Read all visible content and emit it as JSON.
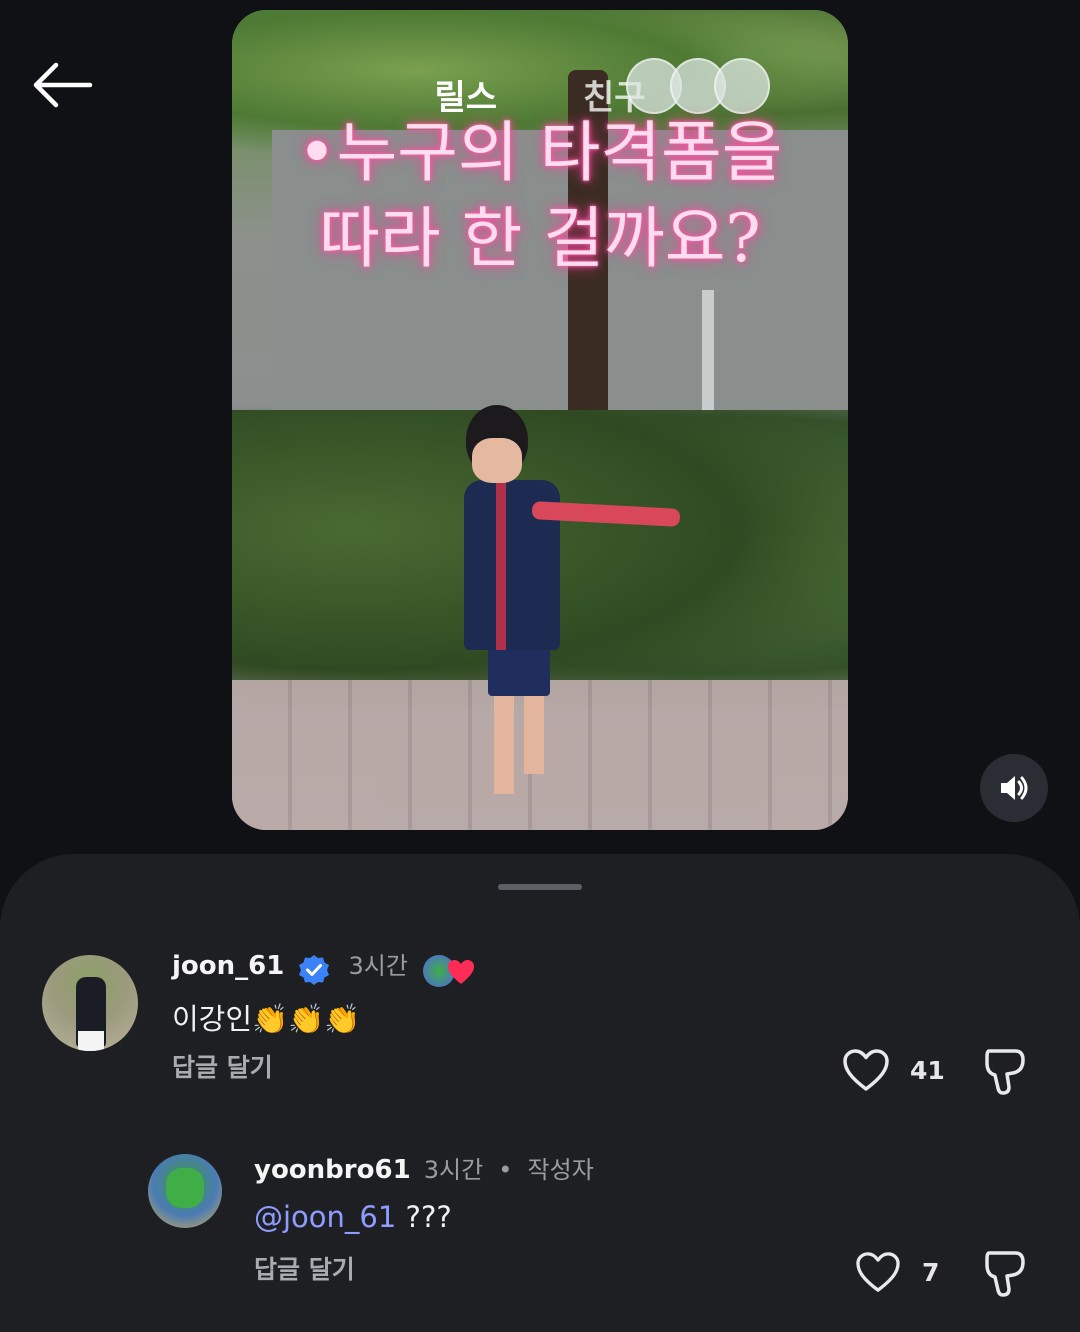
{
  "header": {
    "back_icon": "arrow-left-icon"
  },
  "video": {
    "tabs": [
      "릴스",
      "친구"
    ],
    "caption_line1": "•누구의 타격폼을",
    "caption_line2": "따라 한 걸까요?",
    "sound_icon": "speaker-icon"
  },
  "comments": [
    {
      "username": "joon_61",
      "verified": true,
      "time": "3시간",
      "text": "이강인👏👏👏",
      "reply_label": "답글 달기",
      "likes": "41",
      "liked_by_author": true
    },
    {
      "username": "yoonbro61",
      "time": "3시간",
      "separator": "•",
      "author_badge": "작성자",
      "mention": "@joon_61",
      "text": "???",
      "reply_label": "답글 달기",
      "likes": "7"
    }
  ],
  "colors": {
    "background": "#0f1115",
    "sheet": "#1e1f23",
    "mention": "#8f9cff",
    "verified": "#3b82f6",
    "heart": "#ff2d55",
    "overlay_glow": "#ff3a95"
  }
}
